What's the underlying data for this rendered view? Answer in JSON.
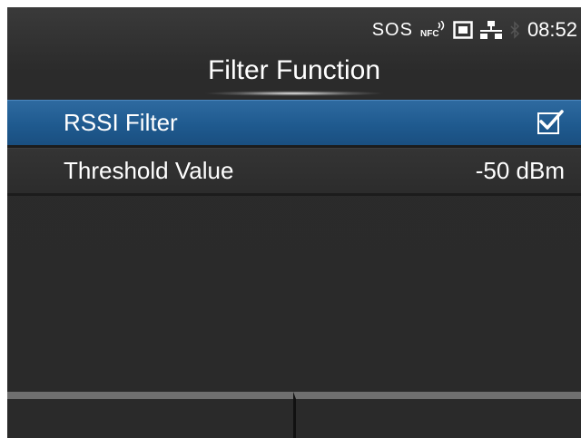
{
  "status": {
    "sos": "SOS",
    "time": "08:52",
    "icons": [
      "nfc-icon",
      "sd-card-icon",
      "network-icon",
      "bluetooth-icon"
    ]
  },
  "header": {
    "title": "Filter Function"
  },
  "menu": {
    "items": [
      {
        "label": "RSSI Filter",
        "checked": true
      },
      {
        "label": "Threshold Value",
        "value": "-50 dBm"
      }
    ]
  },
  "colors": {
    "selected_row": "#1f5a8f",
    "background": "#2b2b2b",
    "function_key": "#6f6f6f"
  }
}
